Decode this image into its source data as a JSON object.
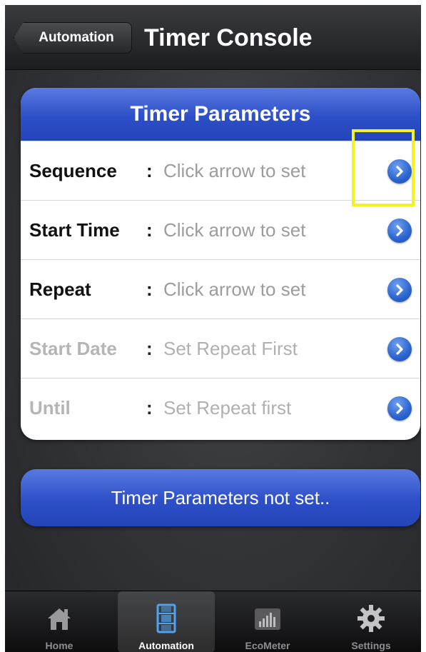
{
  "navbar": {
    "back_label": "Automation",
    "title": "Timer Console"
  },
  "panel": {
    "header": "Timer Parameters",
    "rows": [
      {
        "label": "Sequence",
        "colon": ":",
        "value": "Click arrow to set",
        "enabled": true
      },
      {
        "label": "Start Time",
        "colon": ":",
        "value": "Click arrow to set",
        "enabled": true
      },
      {
        "label": "Repeat",
        "colon": ":",
        "value": "Click arrow to set",
        "enabled": true
      },
      {
        "label": "Start Date",
        "colon": ":",
        "value": "Set Repeat First",
        "enabled": false
      },
      {
        "label": "Until",
        "colon": ":",
        "value": "Set Repeat first",
        "enabled": false
      }
    ],
    "row_icon": "chevron-right-circle-icon"
  },
  "status_button": {
    "label": "Timer Parameters not set.."
  },
  "tabbar": {
    "tabs": [
      {
        "label": "Home",
        "icon": "home-icon",
        "active": false
      },
      {
        "label": "Automation",
        "icon": "film-icon",
        "active": true
      },
      {
        "label": "EcoMeter",
        "icon": "bar-meter-icon",
        "active": false
      },
      {
        "label": "Settings",
        "icon": "gear-icon",
        "active": false
      }
    ]
  },
  "colors": {
    "accent_blue": "#2d4fc8",
    "highlight": "#f7f21c",
    "disclosure_blue": "#2b64cf"
  }
}
